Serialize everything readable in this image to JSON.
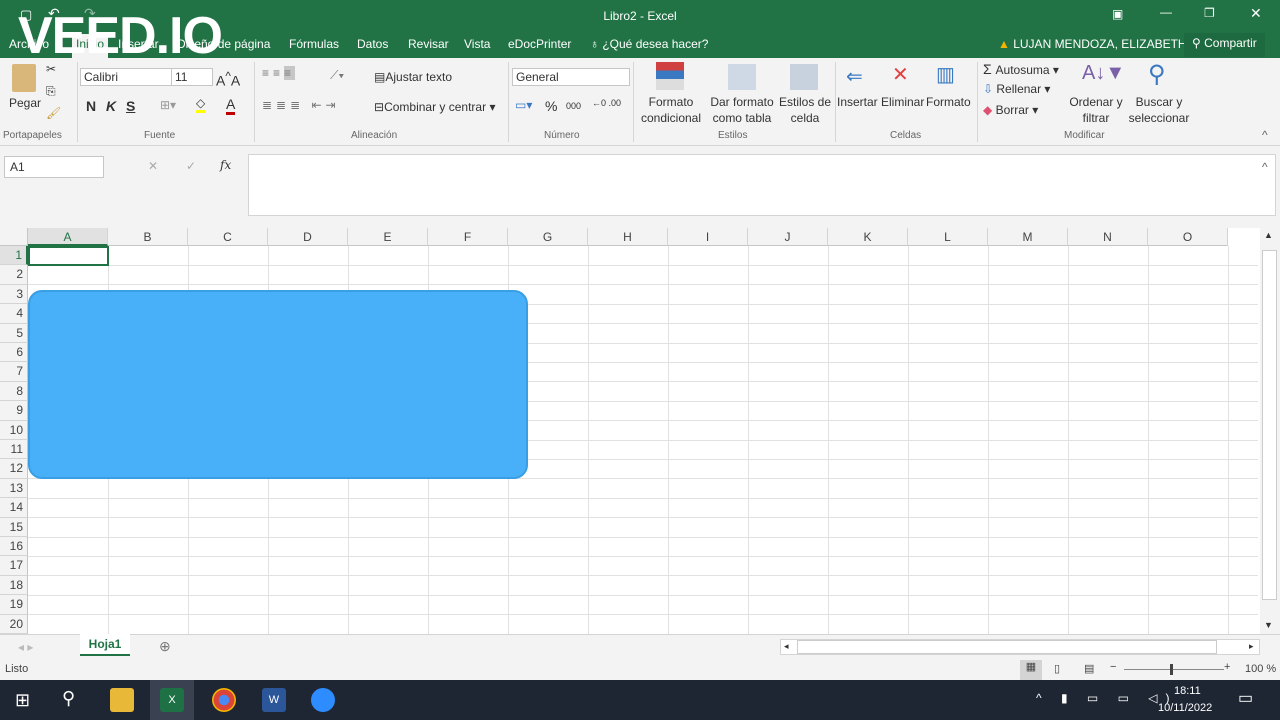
{
  "window": {
    "title": "Libro2 - Excel",
    "watermark": "VEED.IO"
  },
  "tabs": [
    "Archivo",
    "Inicio",
    "Insertar",
    "Diseño de página",
    "Fórmulas",
    "Datos",
    "Revisar",
    "Vista",
    "eDocPrinter"
  ],
  "tell_me": "¿Qué desea hacer?",
  "user": "LUJAN MENDOZA, ELIZABETH",
  "share": "Compartir",
  "ribbon": {
    "paste": "Pegar",
    "font_name": "Calibri",
    "font_size": "11",
    "bold": "N",
    "italic": "K",
    "underline": "S",
    "wrap": "Ajustar texto",
    "merge": "Combinar y centrar",
    "number_format": "General",
    "percent": "%",
    "thousands": "000",
    "cond1": "Formato",
    "cond2": "condicional",
    "tbl1": "Dar formato",
    "tbl2": "como tabla",
    "cs1": "Estilos de",
    "cs2": "celda",
    "insert": "Insertar",
    "delete": "Eliminar",
    "format": "Formato",
    "autosum": "Autosuma",
    "fill": "Rellenar",
    "clear": "Borrar",
    "sort1": "Ordenar y",
    "sort2": "filtrar",
    "find1": "Buscar y",
    "find2": "seleccionar",
    "groups": {
      "clipboard": "Portapapeles",
      "font": "Fuente",
      "align": "Alineación",
      "number": "Número",
      "styles": "Estilos",
      "cells": "Celdas",
      "edit": "Modificar"
    }
  },
  "name_box": "A1",
  "fx": "fx",
  "columns": [
    "A",
    "B",
    "C",
    "D",
    "E",
    "F",
    "G",
    "H",
    "I",
    "J",
    "K",
    "L",
    "M",
    "N",
    "O"
  ],
  "rows": [
    "1",
    "2",
    "3",
    "4",
    "5",
    "6",
    "7",
    "8",
    "9",
    "10",
    "11",
    "12",
    "13",
    "14",
    "15",
    "16",
    "17",
    "18",
    "19",
    "20"
  ],
  "sheet_tab": "Hoja1",
  "status": {
    "ready": "Listo",
    "zoom": "100 %"
  },
  "taskbar": {
    "time": "18:11",
    "date": "10/11/2022"
  }
}
